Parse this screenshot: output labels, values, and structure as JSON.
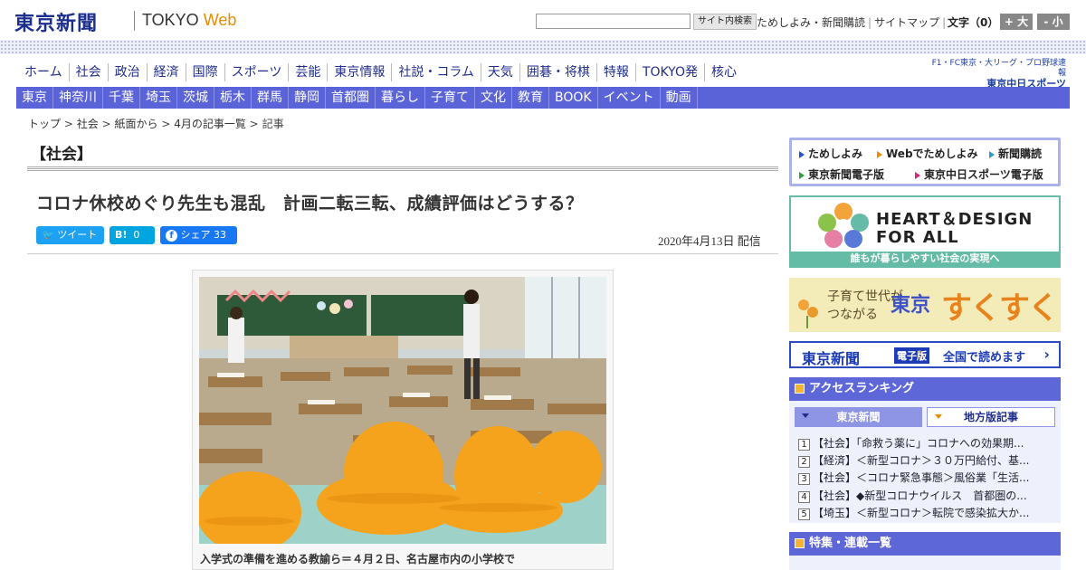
{
  "header": {
    "logo": "東京新聞",
    "site_name_prefix": "TOKYO ",
    "site_name_accent": "Web",
    "search_button": "サイト内検索",
    "links": [
      "ためしよみ・新聞購読",
      "サイトマップ"
    ],
    "font_size_label": "文字（0）",
    "font_bigger": "+ 大",
    "font_smaller": "- 小"
  },
  "nav_main": [
    "ホーム",
    "社会",
    "政治",
    "経済",
    "国際",
    "スポーツ",
    "芸能",
    "東京情報",
    "社説・コラム",
    "天気",
    "囲碁・将棋",
    "特報",
    "TOKYO発",
    "核心"
  ],
  "chunichi": {
    "line1": "F1・FC東京・大リーグ・プロ野球速報",
    "line2": "東京中日スポーツ"
  },
  "nav_region": [
    "東京",
    "神奈川",
    "千葉",
    "埼玉",
    "茨城",
    "栃木",
    "群馬",
    "静岡",
    "首都圏",
    "暮らし",
    "子育て",
    "文化",
    "教育",
    "BOOK",
    "イベント",
    "動画"
  ],
  "breadcrumb": {
    "items": [
      "トップ",
      "社会",
      "紙面から",
      "4月の記事一覧",
      "記事"
    ],
    "separator": ">"
  },
  "article": {
    "category": "【社会】",
    "headline": "コロナ休校めぐり先生も混乱　計画二転三転、成績評価はどうする？",
    "share": {
      "tweet": "ツイート",
      "hatena": "B!",
      "hatena_count": "0",
      "facebook": "シェア",
      "facebook_count": "33"
    },
    "date": "2020年4月13日 配信",
    "photo_caption": "入学式の準備を進める教諭ら＝４月２日、名古屋市内の小学校で"
  },
  "sidebar": {
    "promo_links": [
      "ためしよみ",
      "Webでためしよみ",
      "新聞購読",
      "東京新聞電子版",
      "東京中日スポーツ電子版"
    ],
    "heart_design": {
      "line1": "HEART＆DESIGN",
      "line2": "FOR ALL",
      "band": "誰もが暮らしやすい社会の実現へ"
    },
    "sukusuku": {
      "line1": "子育て世代が",
      "line2": "つながる",
      "brand": "東京",
      "brand2": "すくすく"
    },
    "denshiban": {
      "paper": "東京新聞",
      "badge": "電子版",
      "text": "全国で読めます",
      "arrow": "›"
    },
    "ranking": {
      "title": "アクセスランキング",
      "tab_active": "東京新聞",
      "tab_other": "地方版記事",
      "items": [
        {
          "rank": "1",
          "text": "【社会】「命救う薬に」コロナへの効果期..."
        },
        {
          "rank": "2",
          "text": "【経済】＜新型コロナ＞３０万円給付、基..."
        },
        {
          "rank": "3",
          "text": "【社会】＜コロナ緊急事態＞風俗業「生活..."
        },
        {
          "rank": "4",
          "text": "【社会】◆新型コロナウイルス　首都圏の..."
        },
        {
          "rank": "5",
          "text": "【埼玉】＜新型コロナ＞転院で感染拡大か..."
        }
      ]
    },
    "features_title": "特集・連載一覧"
  },
  "colors": {
    "brand": "#1c2f8f",
    "nav_band": "#5b63d8",
    "accent": "#e98c00",
    "twitter": "#1da1f2",
    "hatena": "#00a4de",
    "facebook": "#1877f2"
  }
}
